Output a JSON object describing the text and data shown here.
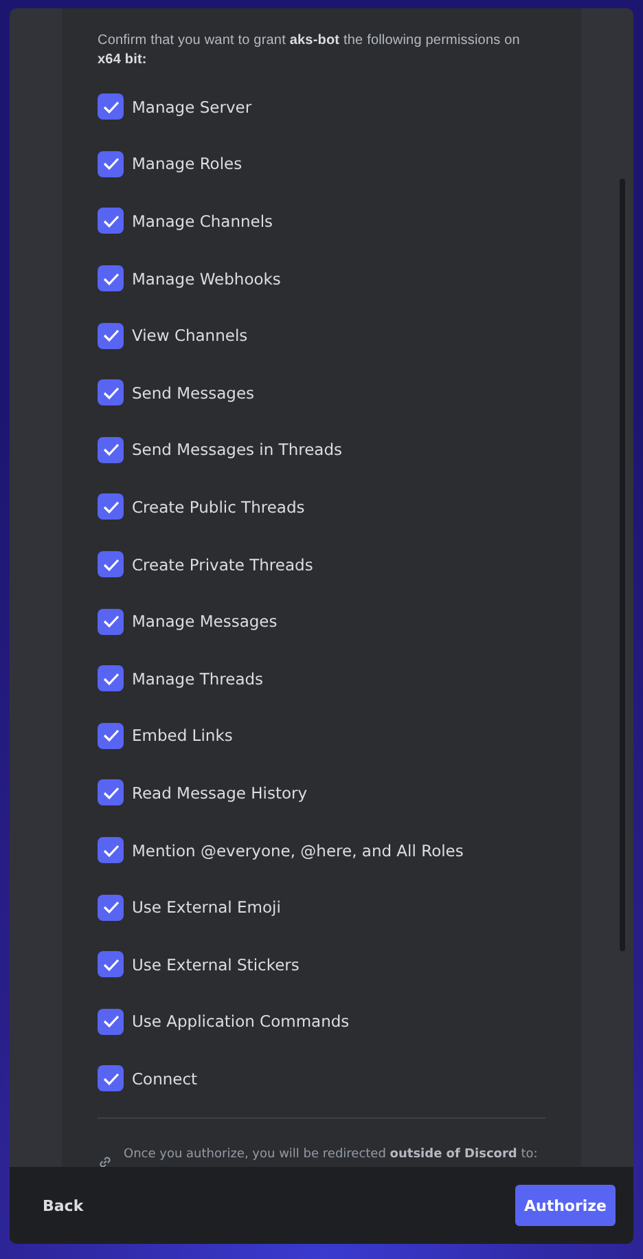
{
  "intro": "Confirm that you want to grant **aks-bot** the following permissions on **x64 bit:**",
  "permissions": [
    {
      "label": "Manage Server",
      "checked": true
    },
    {
      "label": "Manage Roles",
      "checked": true
    },
    {
      "label": "Manage Channels",
      "checked": true
    },
    {
      "label": "Manage Webhooks",
      "checked": true
    },
    {
      "label": "View Channels",
      "checked": true
    },
    {
      "label": "Send Messages",
      "checked": true
    },
    {
      "label": "Send Messages in Threads",
      "checked": true
    },
    {
      "label": "Create Public Threads",
      "checked": true
    },
    {
      "label": "Create Private Threads",
      "checked": true
    },
    {
      "label": "Manage Messages",
      "checked": true
    },
    {
      "label": "Manage Threads",
      "checked": true
    },
    {
      "label": "Embed Links",
      "checked": true
    },
    {
      "label": "Read Message History",
      "checked": true
    },
    {
      "label": "Mention @everyone, @here, and All Roles",
      "checked": true
    },
    {
      "label": "Use External Emoji",
      "checked": true
    },
    {
      "label": "Use External Stickers",
      "checked": true
    },
    {
      "label": "Use Application Commands",
      "checked": true
    },
    {
      "label": "Connect",
      "checked": true
    }
  ],
  "redirect_notice": "Once you authorize, you will be redirected **outside of Discord** to:",
  "footer": {
    "back": "Back",
    "authorize": "Authorize"
  }
}
